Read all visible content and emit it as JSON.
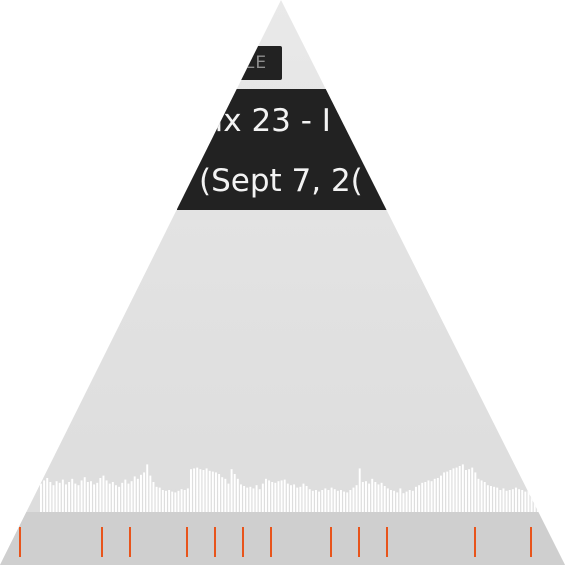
{
  "header": {
    "badge_label": "LE",
    "title_line_1": "nix 23 - I",
    "title_line_2": "(Sept 7, 2("
  },
  "colors": {
    "banner_background": "#222222",
    "banner_text": "#f3f3f3",
    "badge_text": "#8f8f8f",
    "waveform": "#ffffff",
    "timeline_background": "#cfcfcf",
    "marker": "#e8541b"
  },
  "waveform": {
    "levels": [
      0.38,
      0.42,
      0.45,
      0.4,
      0.36,
      0.41,
      0.39,
      0.43,
      0.37,
      0.4,
      0.44,
      0.38,
      0.36,
      0.42,
      0.46,
      0.4,
      0.41,
      0.37,
      0.39,
      0.45,
      0.48,
      0.42,
      0.38,
      0.4,
      0.36,
      0.34,
      0.39,
      0.43,
      0.38,
      0.41,
      0.47,
      0.44,
      0.49,
      0.52,
      0.62,
      0.48,
      0.4,
      0.34,
      0.33,
      0.3,
      0.29,
      0.3,
      0.28,
      0.27,
      0.29,
      0.31,
      0.3,
      0.32,
      0.56,
      0.57,
      0.58,
      0.56,
      0.55,
      0.57,
      0.54,
      0.53,
      0.52,
      0.5,
      0.46,
      0.44,
      0.38,
      0.56,
      0.5,
      0.44,
      0.37,
      0.35,
      0.33,
      0.34,
      0.32,
      0.36,
      0.31,
      0.38,
      0.44,
      0.42,
      0.4,
      0.39,
      0.41,
      0.42,
      0.43,
      0.38,
      0.36,
      0.37,
      0.33,
      0.34,
      0.38,
      0.35,
      0.31,
      0.29,
      0.3,
      0.28,
      0.3,
      0.32,
      0.3,
      0.33,
      0.31,
      0.29,
      0.3,
      0.28,
      0.27,
      0.3,
      0.33,
      0.36,
      0.57,
      0.4,
      0.41,
      0.38,
      0.44,
      0.4,
      0.37,
      0.39,
      0.35,
      0.32,
      0.3,
      0.29,
      0.27,
      0.32,
      0.26,
      0.28,
      0.3,
      0.29,
      0.34,
      0.36,
      0.39,
      0.4,
      0.42,
      0.41,
      0.44,
      0.45,
      0.48,
      0.52,
      0.53,
      0.55,
      0.57,
      0.58,
      0.6,
      0.62,
      0.55,
      0.56,
      0.58,
      0.52,
      0.44,
      0.42,
      0.4,
      0.36,
      0.35,
      0.34,
      0.33,
      0.3,
      0.32,
      0.29,
      0.3,
      0.31,
      0.33,
      0.31,
      0.3,
      0.28,
      0.32,
      0.3,
      0.29,
      0.31
    ]
  },
  "timeline": {
    "marker_positions": [
      0.035,
      0.18,
      0.23,
      0.33,
      0.38,
      0.43,
      0.48,
      0.585,
      0.635,
      0.685,
      0.84,
      0.94
    ]
  }
}
